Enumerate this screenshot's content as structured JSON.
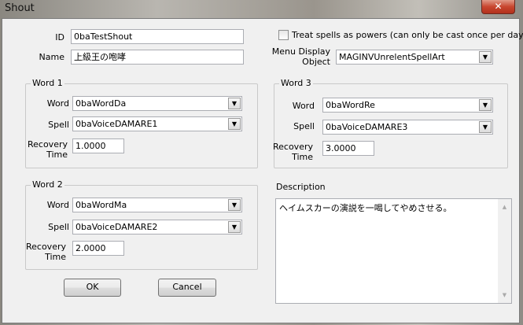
{
  "window": {
    "title": "Shout",
    "close_icon": "close-icon"
  },
  "form": {
    "id_label": "ID",
    "id_value": "0baTestShout",
    "name_label": "Name",
    "name_value": "上級王の咆哮",
    "treat_powers_label": "Treat spells as powers (can only be cast once per day)",
    "treat_powers_checked": false,
    "menu_display_label_1": "Menu Display",
    "menu_display_label_2": "Object",
    "menu_display_value": "MAGINVUnrelentSpellArt",
    "word_label": "Word",
    "spell_label": "Spell",
    "recovery_label_1": "Recovery",
    "recovery_label_2": "Time",
    "words": [
      {
        "title": "Word 1",
        "word": "0baWordDa",
        "spell": "0baVoiceDAMARE1",
        "recovery": "1.0000"
      },
      {
        "title": "Word 2",
        "word": "0baWordMa",
        "spell": "0baVoiceDAMARE2",
        "recovery": "2.0000"
      },
      {
        "title": "Word 3",
        "word": "0baWordRe",
        "spell": "0baVoiceDAMARE3",
        "recovery": "3.0000"
      }
    ],
    "description_label": "Description",
    "description_value": "ヘイムスカーの演説を一喝してやめさせる。"
  },
  "buttons": {
    "ok": "OK",
    "cancel": "Cancel"
  }
}
